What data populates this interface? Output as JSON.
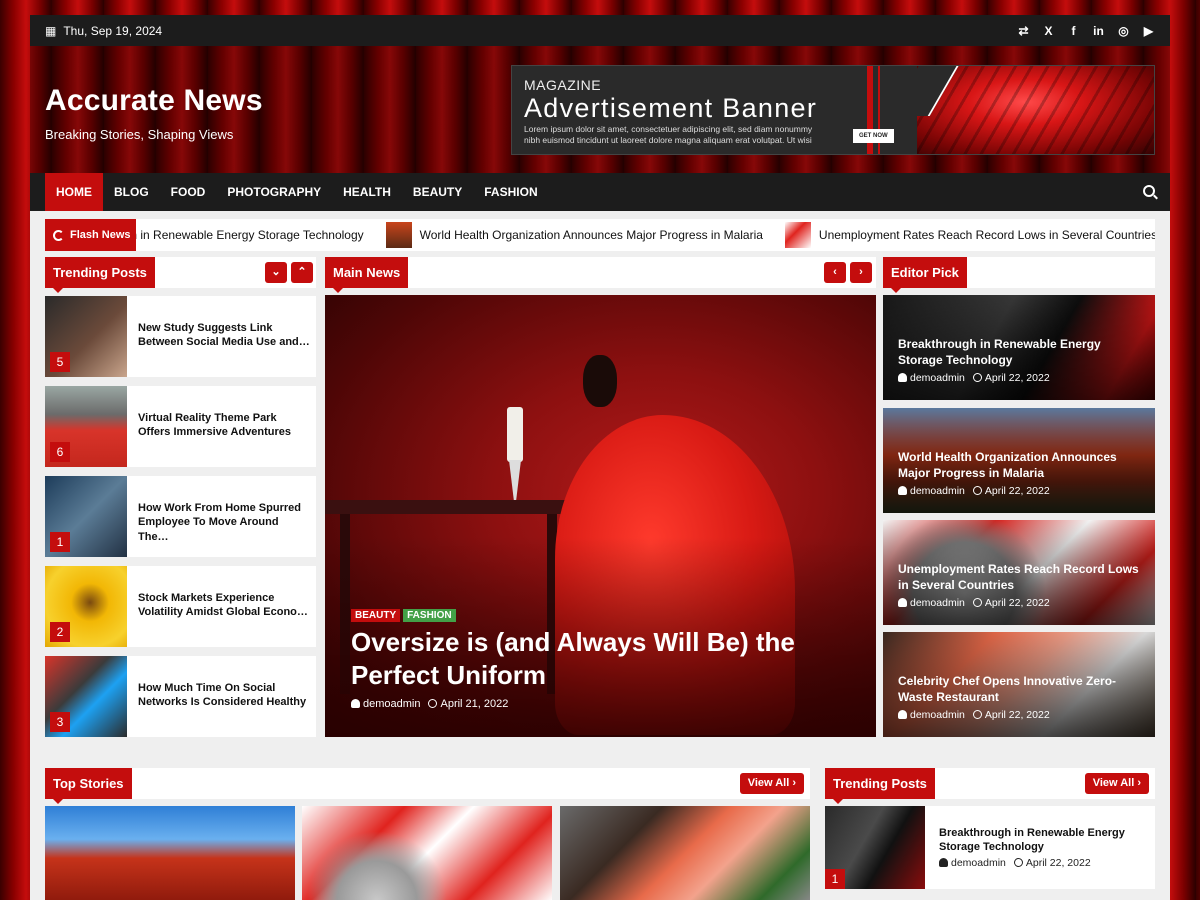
{
  "topbar": {
    "date": "Thu, Sep 19, 2024",
    "social": [
      {
        "icon": "shuffle-icon",
        "glyph": "⇄"
      },
      {
        "icon": "x-icon",
        "glyph": "X"
      },
      {
        "icon": "facebook-icon",
        "glyph": "f"
      },
      {
        "icon": "linkedin-icon",
        "glyph": "in"
      },
      {
        "icon": "instagram-icon",
        "glyph": "◎"
      },
      {
        "icon": "youtube-icon",
        "glyph": "▶"
      }
    ]
  },
  "brand": {
    "title": "Accurate News",
    "tagline": "Breaking Stories, Shaping Views"
  },
  "ad": {
    "eyebrow": "MAGAZINE",
    "title": "Advertisement Banner",
    "body": "Lorem ipsum dolor sit amet, consectetuer adipiscing elit, sed diam nonummy nibh euismod tincidunt ut laoreet dolore magna aliquam erat volutpat. Ut wisi",
    "cta": "GET NOW"
  },
  "nav": [
    "HOME",
    "BLOG",
    "FOOD",
    "PHOTOGRAPHY",
    "HEALTH",
    "BEAUTY",
    "FASHION"
  ],
  "flash": {
    "label": "Flash News",
    "items": [
      "Breakthrough in Renewable Energy Storage Technology",
      "World Health Organization Announces Major Progress in Malaria",
      "Unemployment Rates Reach Record Lows in Several Countries"
    ]
  },
  "trending": {
    "title": "Trending Posts",
    "items": [
      {
        "num": "5",
        "title": "New Study Suggests Link Between Social Media Use and…"
      },
      {
        "num": "6",
        "title": "Virtual Reality Theme Park Offers Immersive Adventures"
      },
      {
        "num": "1",
        "title": "How Work From Home Spurred Employee To Move Around The…"
      },
      {
        "num": "2",
        "title": "Stock Markets Experience Volatility Amidst Global Econo…"
      },
      {
        "num": "3",
        "title": "How Much Time On Social Networks Is Considered Healthy"
      }
    ]
  },
  "main_news": {
    "title": "Main News",
    "tags": [
      "BEAUTY",
      "FASHION"
    ],
    "headline": "Oversize is (and Always Will Be) the Perfect Uniform",
    "author": "demoadmin",
    "date": "April 21, 2022"
  },
  "editor_pick": {
    "title": "Editor Pick",
    "items": [
      {
        "title": "Breakthrough in Renewable Energy Storage Technology",
        "author": "demoadmin",
        "date": "April 22, 2022"
      },
      {
        "title": "World Health Organization Announces Major Progress in Malaria",
        "author": "demoadmin",
        "date": "April 22, 2022"
      },
      {
        "title": "Unemployment Rates Reach Record Lows in Several Countries",
        "author": "demoadmin",
        "date": "April 22, 2022"
      },
      {
        "title": "Celebrity Chef Opens Innovative Zero-Waste Restaurant",
        "author": "demoadmin",
        "date": "April 22, 2022"
      }
    ]
  },
  "top_stories": {
    "title": "Top Stories",
    "view_all": "View All"
  },
  "bottom_trending": {
    "title": "Trending Posts",
    "view_all": "View All",
    "item": {
      "num": "1",
      "title": "Breakthrough in Renewable Energy Storage Technology",
      "author": "demoadmin",
      "date": "April 22, 2022"
    }
  },
  "colors": {
    "accent": "#c40d0d",
    "dark": "#1c1c1c",
    "tag_beauty": "#c40d0d",
    "tag_fashion": "#43a047"
  }
}
